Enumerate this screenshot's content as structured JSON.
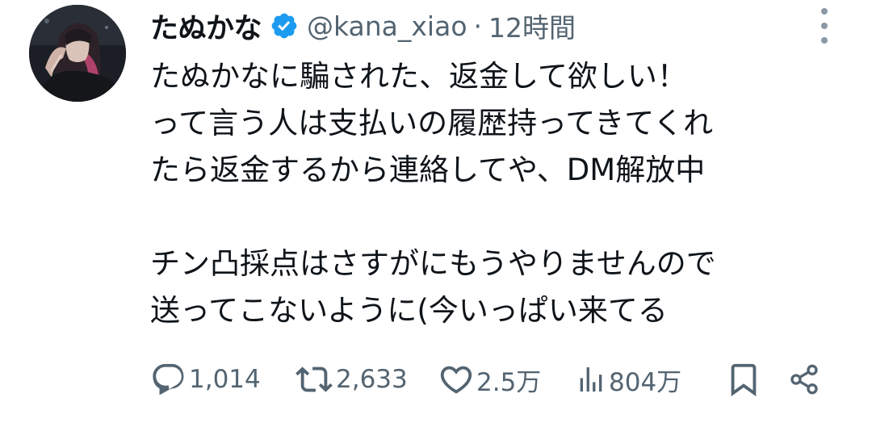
{
  "tweet": {
    "display_name": "たぬかな",
    "verified": true,
    "handle": "@kana_xiao",
    "separator": "·",
    "time": "12時間",
    "body": {
      "line1": "たぬかなに騙された、返金して欲しい！",
      "line2": "って言う人は支払いの履歴持ってきてくれ",
      "line3": "たら返金するから連絡してや、DM解放中",
      "line4": "チン凸採点はさすがにもうやりませんので",
      "line5": "送ってこないように(今いっぱい来てる"
    },
    "stats": {
      "replies": "1,014",
      "retweets": "2,633",
      "likes": "2.5万",
      "views": "804万"
    },
    "icons": {
      "verified": "verified-badge-icon",
      "more": "more-vertical-icon",
      "reply": "reply-icon",
      "retweet": "retweet-icon",
      "like": "heart-icon",
      "views": "views-icon",
      "bookmark": "bookmark-icon",
      "share": "share-icon"
    },
    "colors": {
      "text": "#0f1419",
      "secondary": "#536471",
      "verified": "#1d9bf0"
    }
  }
}
